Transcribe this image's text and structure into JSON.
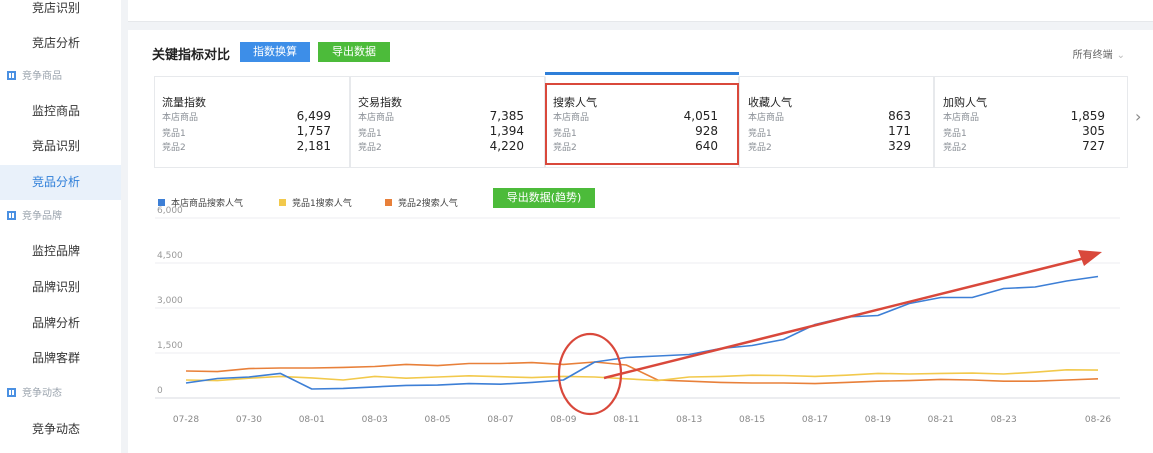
{
  "sidebar": {
    "items": [
      {
        "label": "竞店识别"
      },
      {
        "label": "竞店分析"
      },
      {
        "label": "竞争商品"
      },
      {
        "label": "监控商品"
      },
      {
        "label": "竞品识别"
      },
      {
        "label": "竞品分析"
      },
      {
        "label": "竞争品牌"
      },
      {
        "label": "监控品牌"
      },
      {
        "label": "品牌识别"
      },
      {
        "label": "品牌分析"
      },
      {
        "label": "品牌客群"
      },
      {
        "label": "竞争动态"
      },
      {
        "label": "竞争动态"
      }
    ]
  },
  "panel": {
    "title": "关键指标对比",
    "convert_button": "指数换算",
    "export_button": "导出数据",
    "terminal_select": "所有终端",
    "next_label": "›"
  },
  "metrics": [
    {
      "name": "流量指数",
      "rows": [
        {
          "label": "本店商品",
          "value": "6,499"
        },
        {
          "label": "竞品1",
          "value": "1,757"
        },
        {
          "label": "竞品2",
          "value": "2,181"
        }
      ]
    },
    {
      "name": "交易指数",
      "rows": [
        {
          "label": "本店商品",
          "value": "7,385"
        },
        {
          "label": "竞品1",
          "value": "1,394"
        },
        {
          "label": "竞品2",
          "value": "4,220"
        }
      ]
    },
    {
      "name": "搜索人气",
      "rows": [
        {
          "label": "本店商品",
          "value": "4,051"
        },
        {
          "label": "竞品1",
          "value": "928"
        },
        {
          "label": "竞品2",
          "value": "640"
        }
      ]
    },
    {
      "name": "收藏人气",
      "rows": [
        {
          "label": "本店商品",
          "value": "863"
        },
        {
          "label": "竞品1",
          "value": "171"
        },
        {
          "label": "竞品2",
          "value": "329"
        }
      ]
    },
    {
      "name": "加购人气",
      "rows": [
        {
          "label": "本店商品",
          "value": "1,859"
        },
        {
          "label": "竞品1",
          "value": "305"
        },
        {
          "label": "竞品2",
          "value": "727"
        }
      ]
    }
  ],
  "trend": {
    "export_button": "导出数据(趋势)"
  },
  "colors": {
    "blue": "#3d7fd6",
    "yellow": "#f2c94c",
    "orange": "#e8803a",
    "annotation_red": "#d9483b",
    "accent": "#2f7fd9",
    "green": "#4cbb3a"
  },
  "chart_data": {
    "type": "line",
    "ylim": [
      0,
      6000
    ],
    "yticks": [
      "0",
      "1,500",
      "3,000",
      "4,500",
      "6,000"
    ],
    "ytick_values": [
      0,
      1500,
      3000,
      4500,
      6000
    ],
    "xticks": [
      "07-28",
      "07-30",
      "08-01",
      "08-03",
      "08-05",
      "08-07",
      "08-09",
      "08-11",
      "08-13",
      "08-15",
      "08-17",
      "08-19",
      "08-21",
      "08-23",
      "08-26"
    ],
    "grid": true,
    "legend_position": "top-left",
    "x": [
      "07-28",
      "07-29",
      "07-30",
      "07-31",
      "08-01",
      "08-02",
      "08-03",
      "08-04",
      "08-05",
      "08-06",
      "08-07",
      "08-08",
      "08-09",
      "08-10",
      "08-11",
      "08-12",
      "08-13",
      "08-14",
      "08-15",
      "08-16",
      "08-17",
      "08-18",
      "08-19",
      "08-20",
      "08-21",
      "08-22",
      "08-23",
      "08-24",
      "08-25",
      "08-26"
    ],
    "series": [
      {
        "name": "本店商品搜索人气",
        "color": "#3d7fd6",
        "values": [
          500,
          650,
          700,
          820,
          300,
          320,
          370,
          420,
          430,
          480,
          460,
          520,
          600,
          1200,
          1350,
          1400,
          1450,
          1650,
          1750,
          1950,
          2450,
          2700,
          2750,
          3150,
          3350,
          3350,
          3650,
          3700,
          3900,
          4050
        ]
      },
      {
        "name": "竞品1搜索人气",
        "color": "#f2c94c",
        "values": [
          600,
          580,
          660,
          720,
          670,
          600,
          720,
          660,
          700,
          740,
          710,
          680,
          720,
          700,
          640,
          580,
          700,
          720,
          760,
          750,
          720,
          760,
          820,
          800,
          820,
          830,
          800,
          860,
          940,
          930
        ]
      },
      {
        "name": "竞品2搜索人气",
        "color": "#e8803a",
        "values": [
          900,
          880,
          980,
          1000,
          1000,
          1020,
          1050,
          1120,
          1080,
          1150,
          1150,
          1180,
          1120,
          1200,
          1100,
          600,
          560,
          520,
          500,
          500,
          480,
          520,
          560,
          580,
          620,
          600,
          560,
          560,
          600,
          640
        ]
      }
    ]
  }
}
